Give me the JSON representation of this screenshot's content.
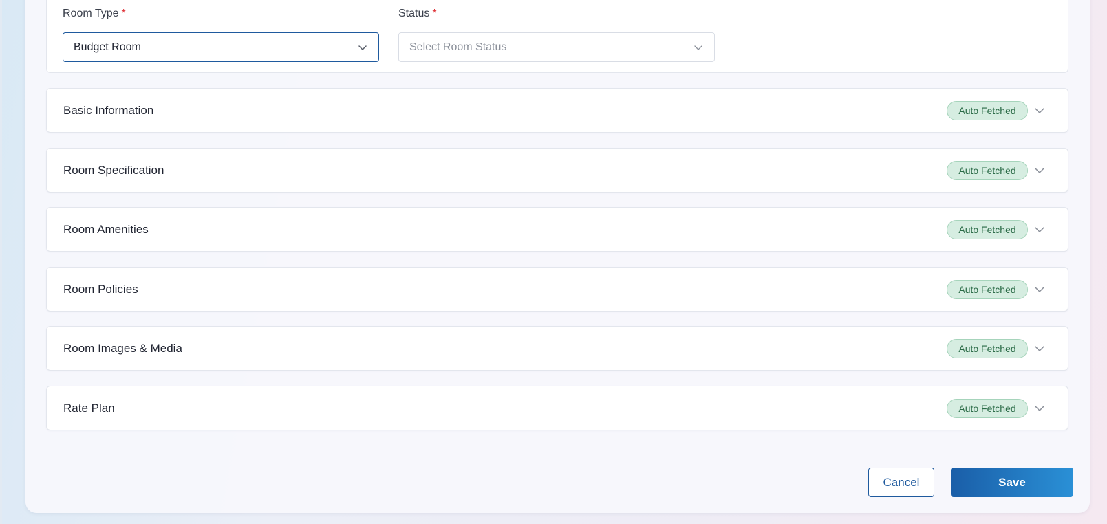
{
  "form": {
    "room_type": {
      "label": "Room Type",
      "required_mark": "*",
      "value": "Budget Room"
    },
    "status": {
      "label": "Status",
      "required_mark": "*",
      "placeholder": "Select Room Status"
    }
  },
  "sections": [
    {
      "title": "Basic Information",
      "badge": "Auto Fetched"
    },
    {
      "title": "Room Specification",
      "badge": "Auto Fetched"
    },
    {
      "title": "Room Amenities",
      "badge": "Auto Fetched"
    },
    {
      "title": "Room Policies",
      "badge": "Auto Fetched"
    },
    {
      "title": "Room Images & Media",
      "badge": "Auto Fetched"
    },
    {
      "title": "Rate Plan",
      "badge": "Auto Fetched"
    }
  ],
  "actions": {
    "cancel_label": "Cancel",
    "save_label": "Save"
  },
  "colors": {
    "primary": "#1f5a9e",
    "required": "#e0353b",
    "badge_bg": "#d6ede1",
    "badge_text": "#2b6b47"
  },
  "icons": {
    "dropdown": "chevron-down-icon",
    "section_toggle": "chevron-down-icon"
  }
}
